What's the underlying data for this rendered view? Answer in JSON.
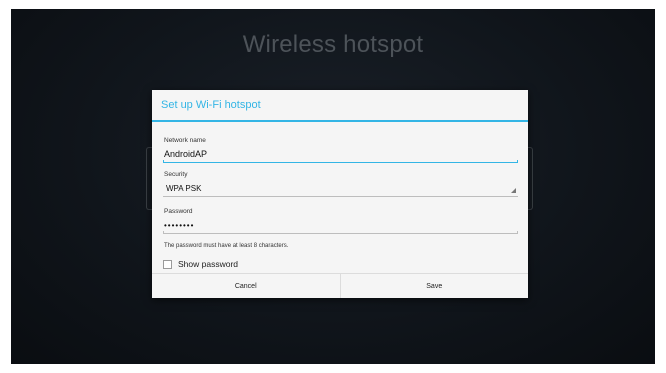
{
  "background": {
    "title": "Wireless hotspot"
  },
  "dialog": {
    "title": "Set up Wi-Fi hotspot",
    "network_name": {
      "label": "Network name",
      "value": "AndroidAP"
    },
    "security": {
      "label": "Security",
      "value": "WPA PSK"
    },
    "password": {
      "label": "Password",
      "value": "••••••••",
      "hint": "The password must have at least 8 characters."
    },
    "show_password": {
      "label": "Show password",
      "checked": false
    },
    "buttons": {
      "cancel": "Cancel",
      "save": "Save"
    }
  },
  "colors": {
    "accent": "#33b5e5",
    "dialog_bg": "#f5f5f5",
    "screen_bg": "#10151b"
  }
}
